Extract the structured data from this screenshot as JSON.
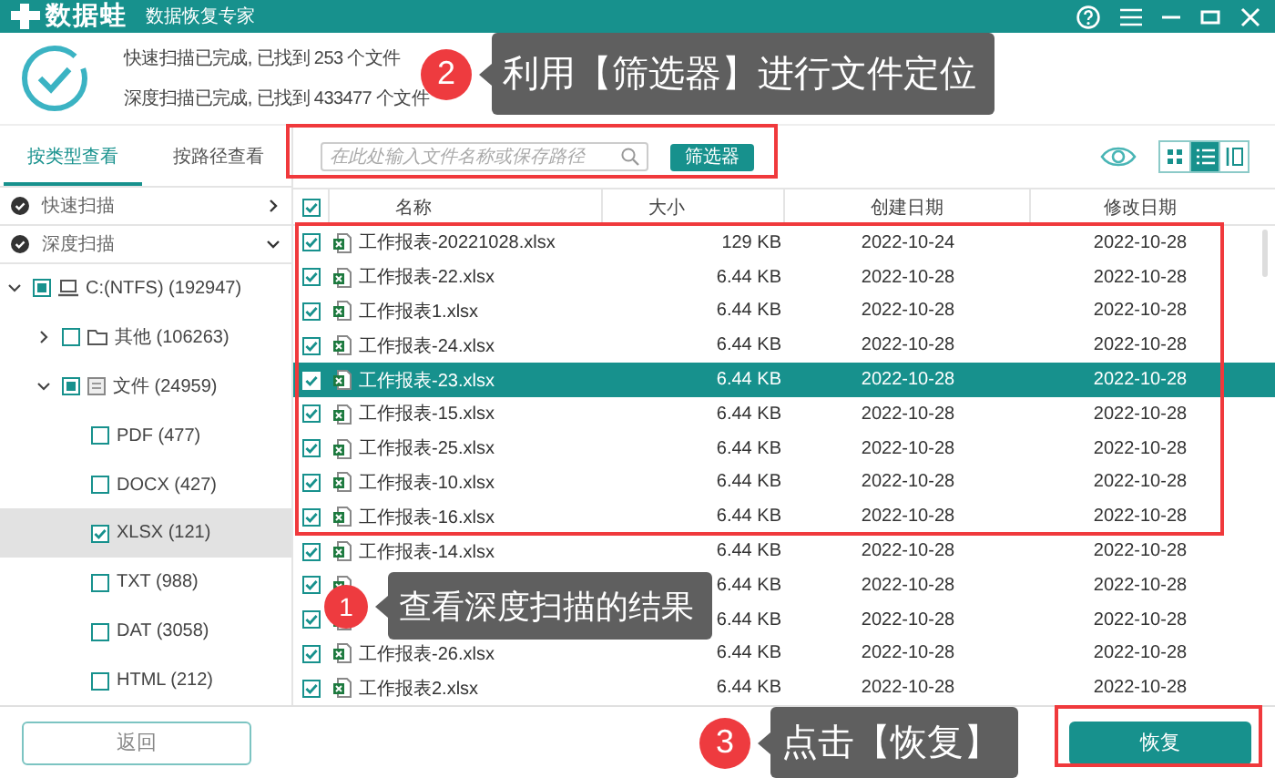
{
  "app": {
    "logo": "数据蛙",
    "subtitle": "数据恢复专家"
  },
  "scan_summary": [
    "快速扫描已完成, 已找到 253 个文件",
    "深度扫描已完成, 已找到 433477 个文件"
  ],
  "view_tabs": [
    {
      "label": "按类型查看",
      "selected": true
    },
    {
      "label": "按路径查看",
      "selected": false
    }
  ],
  "scan_groups": [
    {
      "label": "快速扫描",
      "expanded": false
    },
    {
      "label": "深度扫描",
      "expanded": true
    }
  ],
  "tree": [
    {
      "label": "C:(NTFS) (192947)",
      "checked": false,
      "partial": true,
      "expanded": true,
      "selected": false,
      "children": [
        {
          "label": "其他 (106263)",
          "checked": false,
          "partial": false,
          "expanded": false,
          "selected": false
        },
        {
          "label": "文件 (24959)",
          "checked": false,
          "partial": true,
          "expanded": true,
          "selected": false,
          "children": [
            {
              "label": "PDF (477)",
              "checked": false,
              "partial": false,
              "selected": false
            },
            {
              "label": "DOCX (427)",
              "checked": false,
              "partial": false,
              "selected": false
            },
            {
              "label": "XLSX (121)",
              "checked": true,
              "partial": false,
              "selected": true
            },
            {
              "label": "TXT (988)",
              "checked": false,
              "partial": false,
              "selected": false
            },
            {
              "label": "DAT (3058)",
              "checked": false,
              "partial": false,
              "selected": false
            },
            {
              "label": "HTML (212)",
              "checked": false,
              "partial": false,
              "selected": false
            }
          ]
        }
      ]
    }
  ],
  "search": {
    "placeholder": "在此处输入文件名称或保存路径"
  },
  "filter_button": "筛选器",
  "view_modes": [
    {
      "kind": "grid",
      "selected": false
    },
    {
      "kind": "list",
      "selected": true
    },
    {
      "kind": "columns",
      "selected": false
    }
  ],
  "table": {
    "columns": [
      "名称",
      "大小",
      "创建日期",
      "修改日期"
    ],
    "all_checked": true,
    "rows": [
      {
        "name": "工作报表-20221028.xlsx",
        "size": "129 KB",
        "created": "2022-10-24",
        "modified": "2022-10-28",
        "checked": true,
        "selected": false
      },
      {
        "name": "工作报表-22.xlsx",
        "size": "6.44 KB",
        "created": "2022-10-28",
        "modified": "2022-10-28",
        "checked": true,
        "selected": false
      },
      {
        "name": "工作报表1.xlsx",
        "size": "6.44 KB",
        "created": "2022-10-28",
        "modified": "2022-10-28",
        "checked": true,
        "selected": false
      },
      {
        "name": "工作报表-24.xlsx",
        "size": "6.44 KB",
        "created": "2022-10-28",
        "modified": "2022-10-28",
        "checked": true,
        "selected": false
      },
      {
        "name": "工作报表-23.xlsx",
        "size": "6.44 KB",
        "created": "2022-10-28",
        "modified": "2022-10-28",
        "checked": true,
        "selected": true
      },
      {
        "name": "工作报表-15.xlsx",
        "size": "6.44 KB",
        "created": "2022-10-28",
        "modified": "2022-10-28",
        "checked": true,
        "selected": false
      },
      {
        "name": "工作报表-25.xlsx",
        "size": "6.44 KB",
        "created": "2022-10-28",
        "modified": "2022-10-28",
        "checked": true,
        "selected": false
      },
      {
        "name": "工作报表-10.xlsx",
        "size": "6.44 KB",
        "created": "2022-10-28",
        "modified": "2022-10-28",
        "checked": true,
        "selected": false
      },
      {
        "name": "工作报表-16.xlsx",
        "size": "6.44 KB",
        "created": "2022-10-28",
        "modified": "2022-10-28",
        "checked": true,
        "selected": false
      },
      {
        "name": "工作报表-14.xlsx",
        "size": "6.44 KB",
        "created": "2022-10-28",
        "modified": "2022-10-28",
        "checked": true,
        "selected": false
      },
      {
        "size": "6.44 KB",
        "created": "2022-10-28",
        "modified": "2022-10-28",
        "checked": true,
        "selected": false
      },
      {
        "size": "6.44 KB",
        "created": "2022-10-28",
        "modified": "2022-10-28",
        "checked": true,
        "selected": false
      },
      {
        "name": "工作报表-26.xlsx",
        "size": "6.44 KB",
        "created": "2022-10-28",
        "modified": "2022-10-28",
        "checked": true,
        "selected": false
      },
      {
        "name": "工作报表2.xlsx",
        "size": "6.44 KB",
        "created": "2022-10-28",
        "modified": "2022-10-28",
        "checked": true,
        "selected": false
      }
    ]
  },
  "buttons": {
    "back": "返回",
    "recover": "恢复"
  },
  "callouts": [
    {
      "number": "2",
      "text": "利用【筛选器】进行文件定位"
    },
    {
      "number": "1",
      "text": "查看深度扫描的结果"
    },
    {
      "number": "3",
      "text": "点击【恢复】"
    }
  ]
}
